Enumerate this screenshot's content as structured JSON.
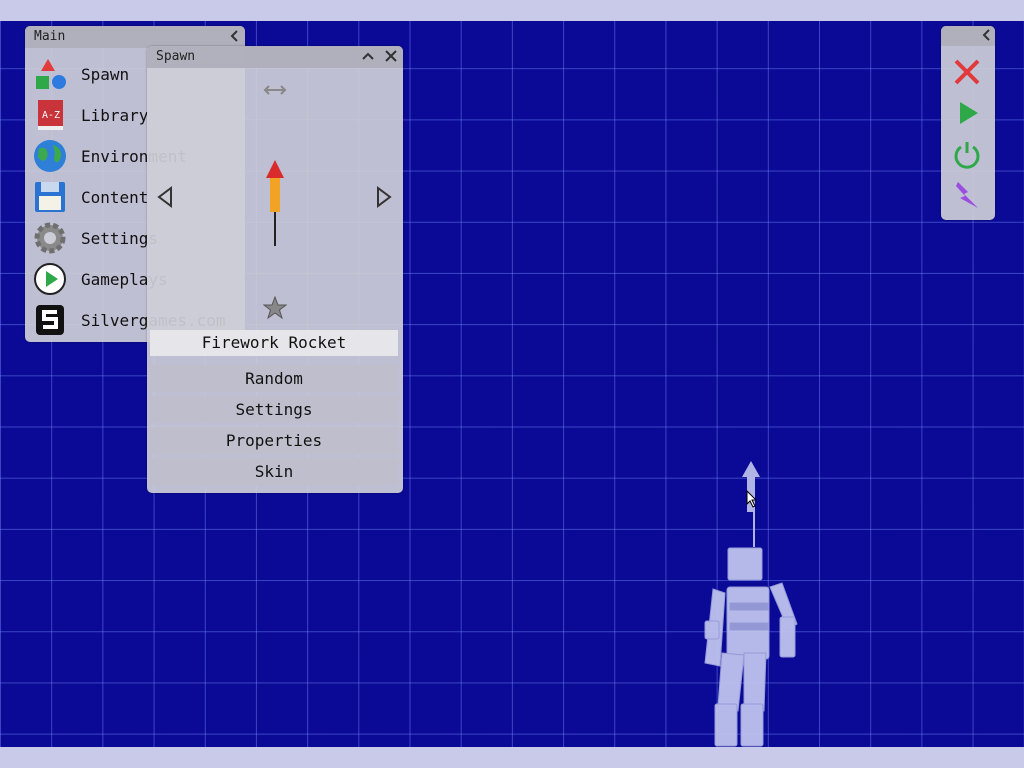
{
  "colors": {
    "stage": "#0a0a96",
    "grid": "#6e82ff",
    "bar": "#c9c9ea",
    "panel": "#cdcdd7",
    "selected": "#e5e5ea"
  },
  "main_panel": {
    "title": "Main",
    "items": [
      {
        "label": "Spawn",
        "icon": "spawn-shapes-icon"
      },
      {
        "label": "Library",
        "icon": "library-book-icon"
      },
      {
        "label": "Environment",
        "icon": "globe-icon"
      },
      {
        "label": "Content",
        "icon": "floppy-disk-icon"
      },
      {
        "label": "Settings",
        "icon": "gear-icon"
      },
      {
        "label": "Gameplays",
        "icon": "play-circle-icon"
      },
      {
        "label": "Silvergames.com",
        "icon": "silvergames-logo-icon"
      }
    ]
  },
  "book_icon_text": "A-Z",
  "spawn_panel": {
    "title": "Spawn",
    "selected_item": "Firework Rocket",
    "buttons": [
      "Random",
      "Settings",
      "Properties",
      "Skin"
    ]
  },
  "tool_panel": {
    "tools": [
      "close-x-icon",
      "play-icon",
      "power-icon",
      "lightning-icon"
    ]
  }
}
